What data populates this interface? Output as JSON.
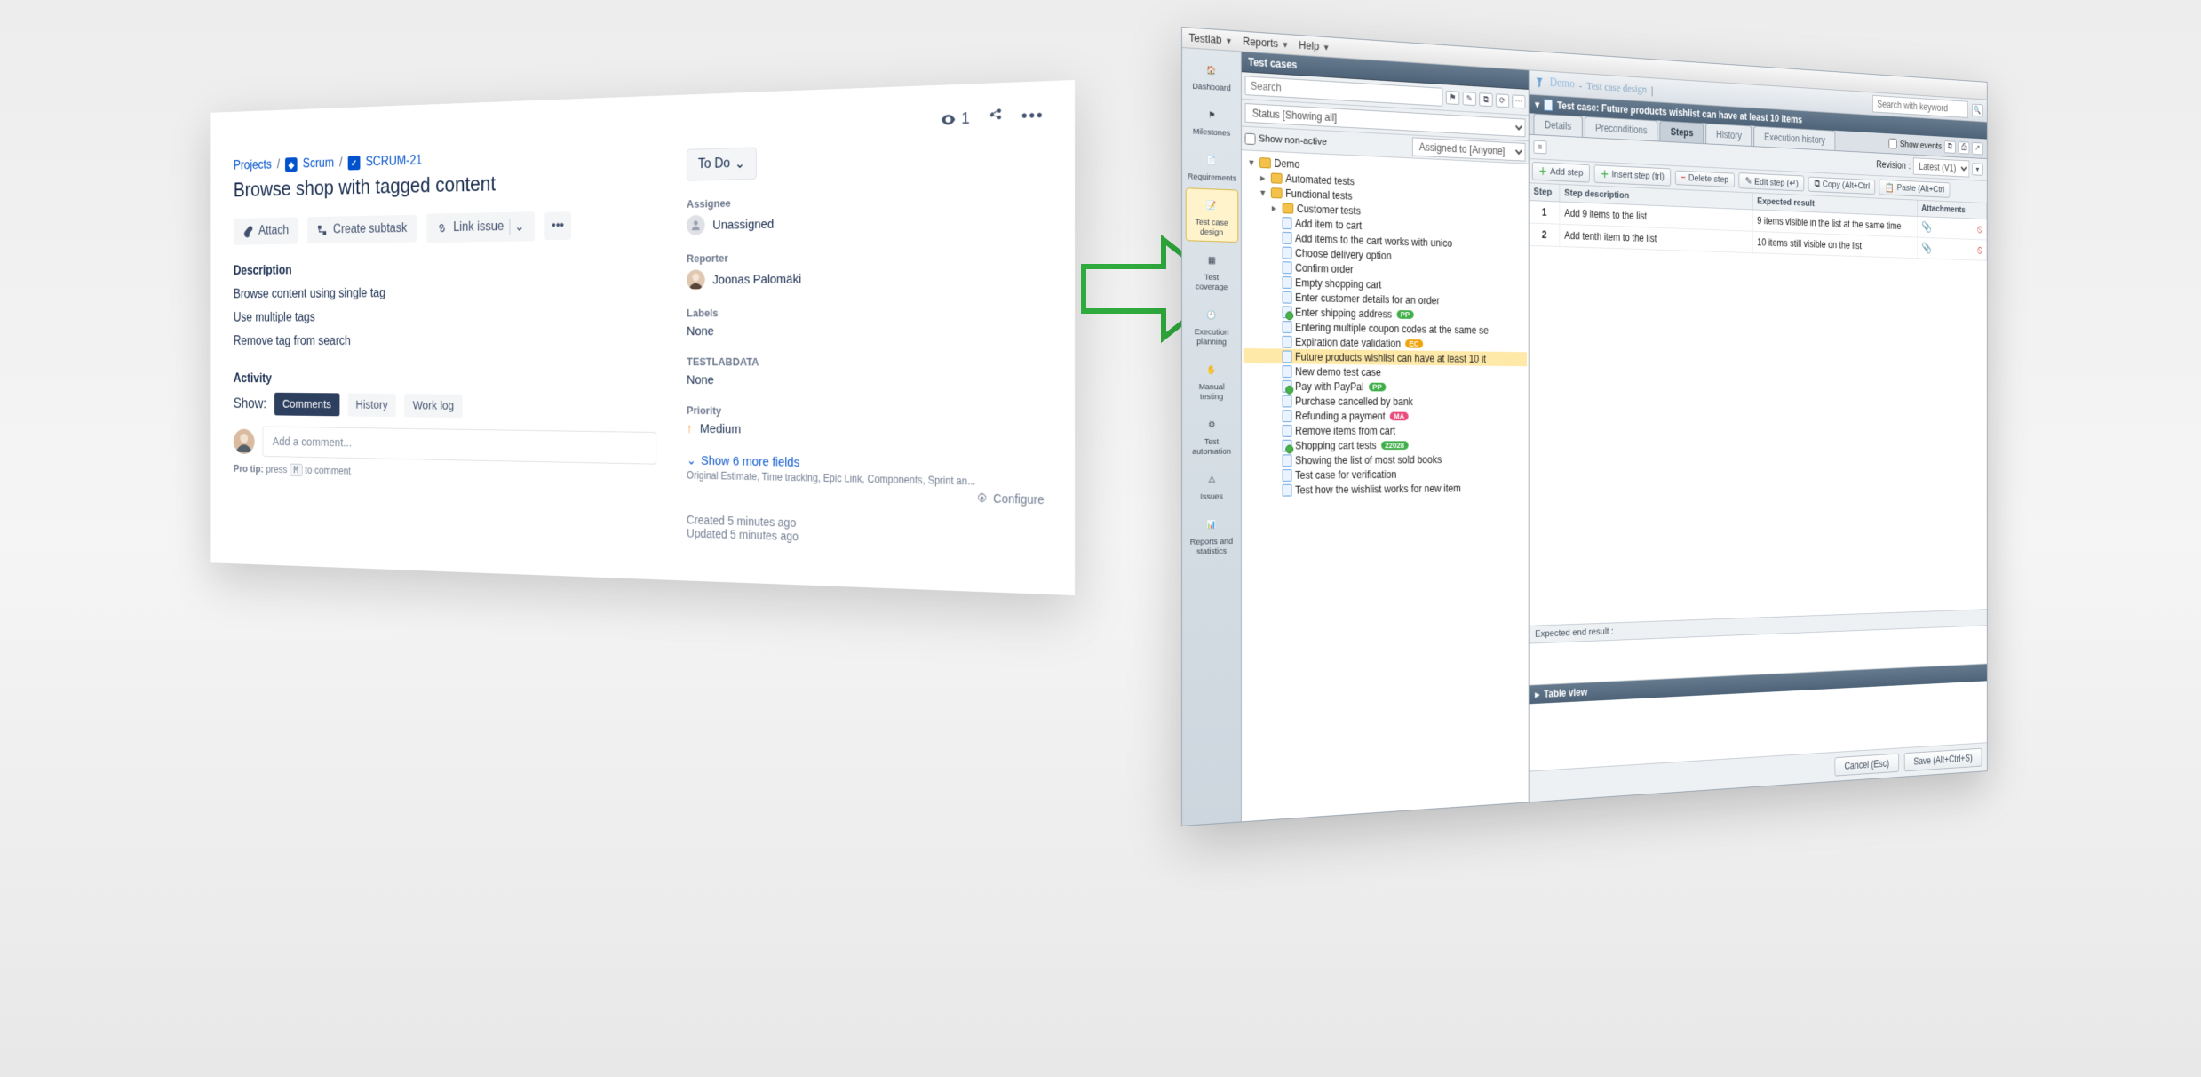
{
  "jira": {
    "watch_count": "1",
    "breadcrumb": {
      "l1": "Projects",
      "l2": "Scrum",
      "key": "SCRUM-21"
    },
    "title": "Browse shop with tagged content",
    "actions": {
      "attach": "Attach",
      "subtask": "Create subtask",
      "link": "Link issue"
    },
    "description_heading": "Description",
    "desc_lines": [
      "Browse content using single tag",
      "Use multiple tags",
      "Remove tag from search"
    ],
    "activity_heading": "Activity",
    "show_label": "Show:",
    "tabs": [
      "Comments",
      "History",
      "Work log"
    ],
    "comment_placeholder": "Add a comment...",
    "protip_prefix": "Pro tip:",
    "protip_text": "press",
    "protip_key": "M",
    "protip_suffix": "to comment",
    "status": "To Do",
    "fields": {
      "assignee_label": "Assignee",
      "assignee_value": "Unassigned",
      "reporter_label": "Reporter",
      "reporter_value": "Joonas Palomäki",
      "labels_label": "Labels",
      "labels_value": "None",
      "testlab_label": "TESTLABDATA",
      "testlab_value": "None",
      "priority_label": "Priority",
      "priority_value": "Medium"
    },
    "more_fields": "Show 6 more fields",
    "more_fields_sub": "Original Estimate, Time tracking, Epic Link, Components, Sprint an...",
    "configure": "Configure",
    "created": "Created 5 minutes ago",
    "updated": "Updated 5 minutes ago"
  },
  "testlab": {
    "menubar": [
      "Testlab",
      "Reports",
      "Help"
    ],
    "sidebar": [
      {
        "label": "Dashboard",
        "icon": "home"
      },
      {
        "label": "Milestones",
        "icon": "flag"
      },
      {
        "label": "Requirements",
        "icon": "req"
      },
      {
        "label": "Test case design",
        "icon": "doc",
        "active": true
      },
      {
        "label": "Test coverage",
        "icon": "grid"
      },
      {
        "label": "Execution planning",
        "icon": "clock"
      },
      {
        "label": "Manual testing",
        "icon": "hand"
      },
      {
        "label": "Test automation",
        "icon": "gear"
      },
      {
        "label": "Issues",
        "icon": "warn"
      },
      {
        "label": "Reports and statistics",
        "icon": "chart"
      }
    ],
    "tree_panel": {
      "title": "Test cases",
      "search_placeholder": "Search",
      "status_filter": "Status [Showing all]",
      "assigned_filter": "Assigned to [Anyone]",
      "show_nonactive_label": "Show non-active",
      "root": "Demo",
      "folders": [
        {
          "name": "Automated tests"
        },
        {
          "name": "Functional tests",
          "open": true,
          "children": [
            {
              "name": "Customer tests",
              "folder": true
            },
            {
              "name": "Add item to cart"
            },
            {
              "name": "Add items to the cart works with unico"
            },
            {
              "name": "Choose delivery option"
            },
            {
              "name": "Confirm order"
            },
            {
              "name": "Empty shopping cart"
            },
            {
              "name": "Enter customer details for an order"
            },
            {
              "name": "Enter shipping address",
              "pill": "PP",
              "pillClass": "pp"
            },
            {
              "name": "Entering multiple coupon codes at the same se"
            },
            {
              "name": "Expiration date validation",
              "pill": "EC",
              "pillClass": "ec"
            },
            {
              "name": "Future products wishlist can have at least 10 it",
              "selected": true
            },
            {
              "name": "New demo test case"
            },
            {
              "name": "Pay with PayPal",
              "pill": "PP",
              "pillClass": "pp"
            },
            {
              "name": "Purchase cancelled by bank"
            },
            {
              "name": "Refunding a payment",
              "pill": "MA",
              "pillClass": "ma"
            },
            {
              "name": "Remove items from cart"
            },
            {
              "name": "Shopping cart tests",
              "pill": "22028",
              "pillClass": "long"
            },
            {
              "name": "Showing the list of most sold books"
            },
            {
              "name": "Test case for verification"
            },
            {
              "name": "Test how the wishlist works for new item"
            }
          ]
        }
      ]
    },
    "right": {
      "brand": "Demo",
      "brand_sub": "Test case design",
      "search_kw_placeholder": "Search with keyword",
      "case_title": "Test case: Future products wishlist can have at least 10 items",
      "tabs": [
        "Details",
        "Steps",
        "History",
        "Execution history"
      ],
      "tabs_ghost": "Preconditions",
      "show_events": "Show events",
      "revision_label": "Revision",
      "revision_value": "Latest (V1)",
      "step_buttons": {
        "add": "Add step",
        "insert": "Insert step (trl)",
        "delete": "Delete step",
        "edit": "Edit step (↵)",
        "copy": "Copy (Alt+Ctrl",
        "paste": "Paste (Alt+Ctrl"
      },
      "grid_headers": [
        "Step",
        "Step description",
        "Expected result",
        "Attachments"
      ],
      "grid_rows": [
        {
          "n": "1",
          "desc": "Add 9 items to the list",
          "exp": "9 items visible in the list at the same time"
        },
        {
          "n": "2",
          "desc": "Add tenth item to the list",
          "exp": "10 items still visible on the list"
        }
      ],
      "expected_end_label": "Expected end result :",
      "table_view_label": "Table view",
      "footer": {
        "cancel": "Cancel (Esc)",
        "save": "Save (Alt+Ctrl+S)"
      }
    }
  }
}
